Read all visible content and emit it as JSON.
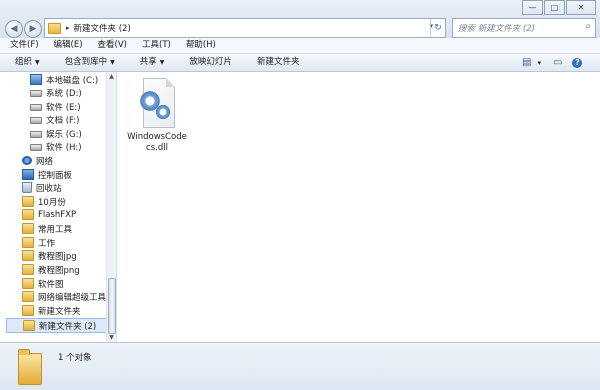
{
  "window": {
    "minimize_label": "—",
    "maximize_label": "□",
    "close_label": "✕"
  },
  "nav": {
    "back": "◀",
    "forward": "▶"
  },
  "address": {
    "crumb": "新建文件夹 (2)",
    "separator": "▸",
    "dropdown": "▾",
    "refresh": "↻"
  },
  "search": {
    "placeholder": "搜索 新建文件夹 (2)",
    "icon": "⌕"
  },
  "menu": [
    "文件(F)",
    "编辑(E)",
    "查看(V)",
    "工具(T)",
    "帮助(H)"
  ],
  "toolbar": {
    "organize": "组织",
    "include_library": "包含到库中",
    "share": "共享",
    "slideshow": "放映幻灯片",
    "new_folder": "新建文件夹",
    "view_icon": "▤",
    "view_arrow": "▾",
    "pane_icon": "▭",
    "help_icon": "?"
  },
  "sidebar": {
    "items": [
      {
        "label": "本地磁盘 (C:)",
        "icon": "system-drive-icon",
        "indent": 2
      },
      {
        "label": "系统 (D:)",
        "icon": "drive-icon",
        "indent": 2
      },
      {
        "label": "软件 (E:)",
        "icon": "drive-icon",
        "indent": 2
      },
      {
        "label": "文档 (F:)",
        "icon": "drive-icon",
        "indent": 2
      },
      {
        "label": "娱乐 (G:)",
        "icon": "drive-icon",
        "indent": 2
      },
      {
        "label": "软件 (H:)",
        "icon": "drive-icon",
        "indent": 2
      },
      {
        "label": "网络",
        "icon": "network-icon",
        "indent": 1
      },
      {
        "label": "控制面板",
        "icon": "control-panel-icon",
        "indent": 1
      },
      {
        "label": "回收站",
        "icon": "recycle-bin-icon",
        "indent": 1
      },
      {
        "label": "10月份",
        "icon": "folder-icon",
        "indent": 1
      },
      {
        "label": "FlashFXP",
        "icon": "folder-icon",
        "indent": 1
      },
      {
        "label": "常用工具",
        "icon": "folder-icon",
        "indent": 1
      },
      {
        "label": "工作",
        "icon": "folder-icon",
        "indent": 1
      },
      {
        "label": "教程图jpg",
        "icon": "folder-icon",
        "indent": 1
      },
      {
        "label": "教程图png",
        "icon": "folder-icon",
        "indent": 1
      },
      {
        "label": "软件图",
        "icon": "folder-icon",
        "indent": 1
      },
      {
        "label": "网络编辑超级工具箱",
        "icon": "folder-icon",
        "indent": 1
      },
      {
        "label": "新建文件夹",
        "icon": "folder-icon",
        "indent": 1
      },
      {
        "label": "新建文件夹 (2)",
        "icon": "folder-icon",
        "indent": 1,
        "selected": true
      }
    ]
  },
  "content": {
    "files": [
      {
        "name": "WindowsCodecs.dll",
        "icon": "dll-file-icon"
      }
    ]
  },
  "details": {
    "count": "1 个对象"
  }
}
